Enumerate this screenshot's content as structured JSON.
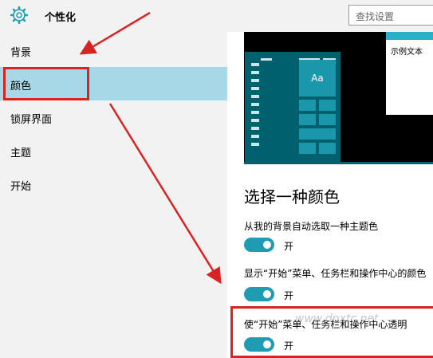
{
  "header": {
    "title": "个性化",
    "search_placeholder": "查找设置",
    "settings_icon": "gear-icon"
  },
  "sidebar": {
    "items": [
      {
        "label": "背景"
      },
      {
        "label": "颜色",
        "selected": true
      },
      {
        "label": "锁屏界面"
      },
      {
        "label": "主题"
      },
      {
        "label": "开始"
      }
    ]
  },
  "preview": {
    "tile_label": "Aa",
    "sample_text": "示例文本"
  },
  "main": {
    "heading": "选择一种颜色",
    "settings": [
      {
        "label": "从我的背景自动选取一种主题色",
        "toggle": "开"
      },
      {
        "label": "显示“开始”菜单、任务栏和操作中心的颜色",
        "toggle": "开"
      },
      {
        "label": "使“开始”菜单、任务栏和操作中心透明",
        "toggle": "开"
      }
    ]
  },
  "watermark": "www.dnxtc.net",
  "colors": {
    "accent": "#1f9bb2",
    "sidebar_selected": "#a6d8e7",
    "annotation": "#d82323"
  }
}
